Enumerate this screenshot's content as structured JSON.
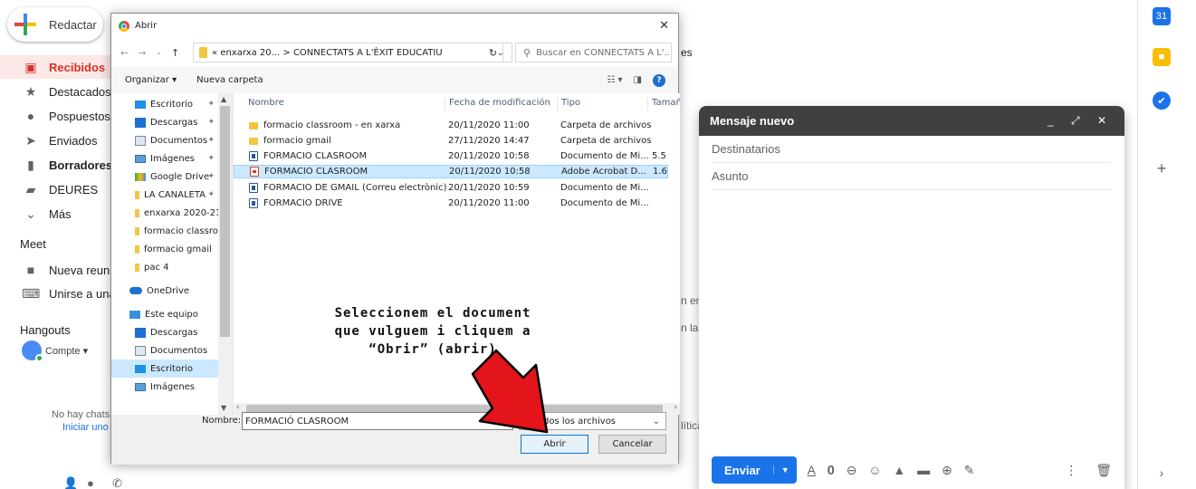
{
  "gmail": {
    "compose_label": "Redactar",
    "nav": [
      {
        "label": "Recibidos",
        "icon": "inbox-icon"
      },
      {
        "label": "Destacados",
        "icon": "star-icon"
      },
      {
        "label": "Pospuestos",
        "icon": "clock-icon"
      },
      {
        "label": "Enviados",
        "icon": "send-icon"
      },
      {
        "label": "Borradores",
        "icon": "draft-icon"
      },
      {
        "label": "DEURES",
        "icon": "label-icon"
      },
      {
        "label": "Más",
        "icon": "chevron-down-icon"
      }
    ],
    "meet": {
      "title": "Meet",
      "new_meeting": "Nueva reunió",
      "join": "Unirse a una"
    },
    "hangouts": {
      "title": "Hangouts",
      "account": "Compte",
      "no_chats": "No hay chats",
      "start": "Iniciar uno"
    },
    "bg_fragments": {
      "f1": "es",
      "f2": "n en c",
      "f3": "n la c",
      "f4": "lítica"
    }
  },
  "compose": {
    "title": "Mensaje nuevo",
    "to_placeholder": "Destinatarios",
    "subject_placeholder": "Asunto",
    "send_label": "Enviar"
  },
  "dialog": {
    "title": "Abrir",
    "address": {
      "path_prefix": "«",
      "path1": "enxarxa 20...",
      "separator": ">",
      "path2": "CONNECTATS A L'ÈXIT EDUCATIU"
    },
    "search_placeholder": "Buscar en CONNECTATS A L'...",
    "toolbar": {
      "organize": "Organizar ▾",
      "new_folder": "Nueva carpeta"
    },
    "tree": [
      {
        "label": "Escritorio",
        "icon": "desktop-icon",
        "pinned": true
      },
      {
        "label": "Descargas",
        "icon": "downloads-icon",
        "pinned": true
      },
      {
        "label": "Documentos",
        "icon": "documents-icon",
        "pinned": true
      },
      {
        "label": "Imágenes",
        "icon": "pictures-icon",
        "pinned": true
      },
      {
        "label": "Google Drive",
        "icon": "google-drive-icon",
        "pinned": true
      },
      {
        "label": "LA CANALETA",
        "icon": "folder-icon",
        "pinned": true
      },
      {
        "label": "enxarxa 2020-21",
        "icon": "folder-icon",
        "pinned": false
      },
      {
        "label": "formacio classro",
        "icon": "folder-icon",
        "pinned": false
      },
      {
        "label": "formacio gmail",
        "icon": "folder-icon",
        "pinned": false
      },
      {
        "label": "pac 4",
        "icon": "folder-icon",
        "pinned": false
      },
      {
        "label": "OneDrive",
        "icon": "onedrive-icon",
        "pinned": false
      },
      {
        "label": "Este equipo",
        "icon": "this-pc-icon",
        "pinned": false
      },
      {
        "label": "Descargas",
        "icon": "downloads-icon",
        "pinned": false
      },
      {
        "label": "Documentos",
        "icon": "documents-icon",
        "pinned": false
      },
      {
        "label": "Escritorio",
        "icon": "desktop-icon",
        "pinned": false,
        "selected": true
      },
      {
        "label": "Imágenes",
        "icon": "pictures-icon",
        "pinned": false
      }
    ],
    "columns": {
      "name": "Nombre",
      "date": "Fecha de modificación",
      "type": "Tipo",
      "size": "Tamañ"
    },
    "files": [
      {
        "name": "formacio classroom - en xarxa",
        "date": "20/11/2020 11:00",
        "type": "Carpeta de archivos",
        "size": "",
        "icon": "folder"
      },
      {
        "name": "formacio gmail",
        "date": "27/11/2020 14:47",
        "type": "Carpeta de archivos",
        "size": "",
        "icon": "folder"
      },
      {
        "name": "FORMACIÓ CLASROOM",
        "date": "20/11/2020 10:58",
        "type": "Documento de Mi...",
        "size": "5.5",
        "icon": "word"
      },
      {
        "name": "FORMACIÓ CLASROOM",
        "date": "20/11/2020 10:58",
        "type": "Adobe Acrobat D...",
        "size": "1.6",
        "icon": "pdf",
        "selected": true
      },
      {
        "name": "FORMACIÓ DE GMAIL (Correu electrònic)",
        "date": "20/11/2020 10:59",
        "type": "Documento de Mi...",
        "size": "",
        "icon": "word"
      },
      {
        "name": "FORMACIÓ DRIVE",
        "date": "20/11/2020 11:00",
        "type": "Documento de Mi...",
        "size": "",
        "icon": "word"
      }
    ],
    "filename_label": "Nombre:",
    "filename_value": "FORMACIÓ CLASROOM",
    "filetype_value": "dos los archivos",
    "open_label": "Abrir",
    "cancel_label": "Cancelar"
  },
  "annotation": {
    "line1": "Seleccionem el document",
    "line2": "que vulguem i cliquem a",
    "line3": "“Obrir” (abrir)"
  },
  "colors": {
    "gmail_red": "#d93025",
    "accent_blue": "#1a73e8",
    "selection": "#cce8ff",
    "arrow_red": "#e3151a"
  }
}
